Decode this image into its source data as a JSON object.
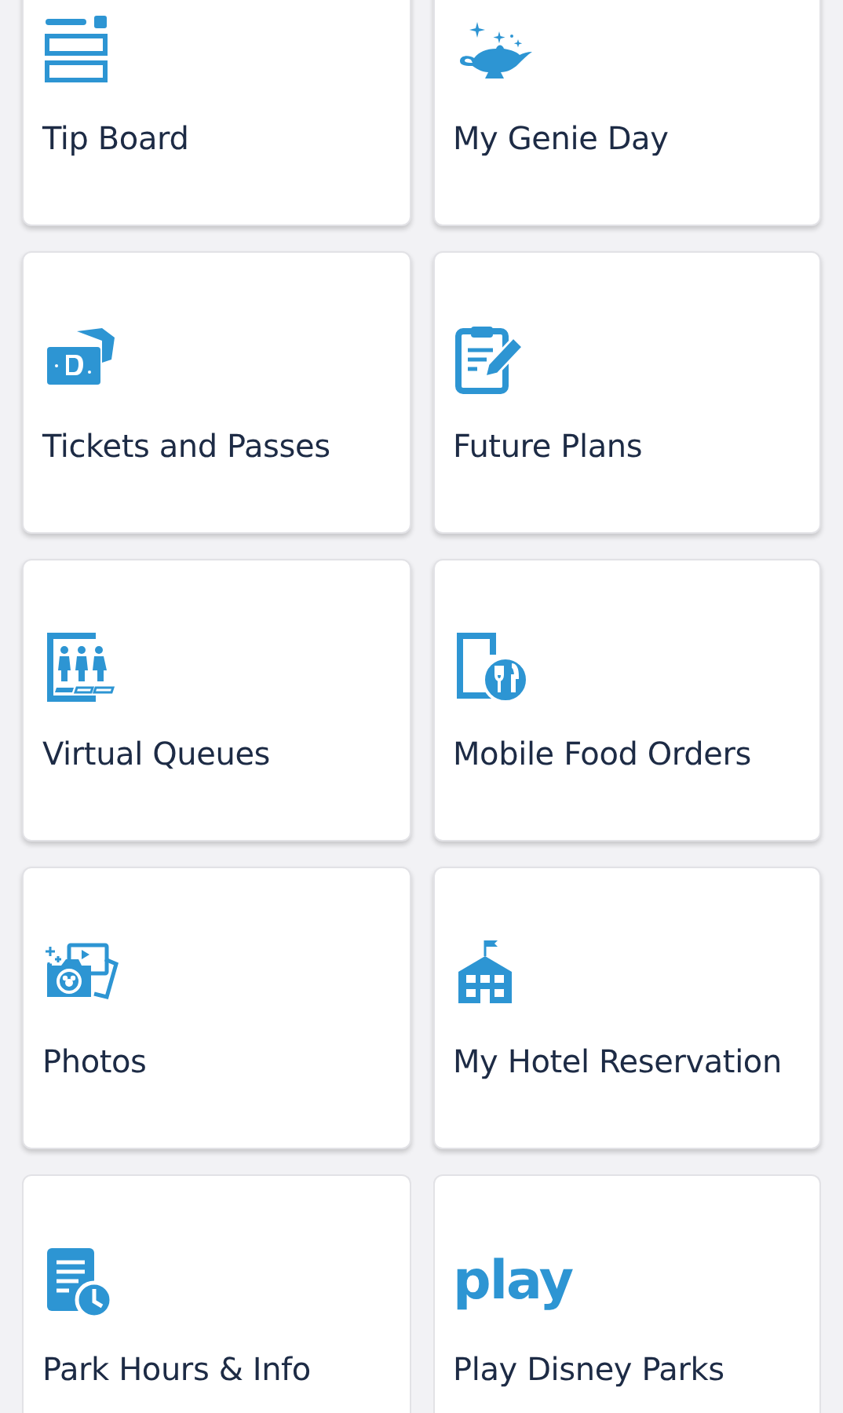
{
  "tiles": [
    {
      "label": "Tip Board"
    },
    {
      "label": "My Genie Day"
    },
    {
      "label": "Tickets and Passes"
    },
    {
      "label": "Future Plans"
    },
    {
      "label": "Virtual Queues"
    },
    {
      "label": "Mobile Food Orders"
    },
    {
      "label": "Photos"
    },
    {
      "label": "My Hotel Reservation"
    },
    {
      "label": "Park Hours & Info"
    },
    {
      "label": "Play Disney Parks"
    }
  ],
  "play_logo": "play"
}
